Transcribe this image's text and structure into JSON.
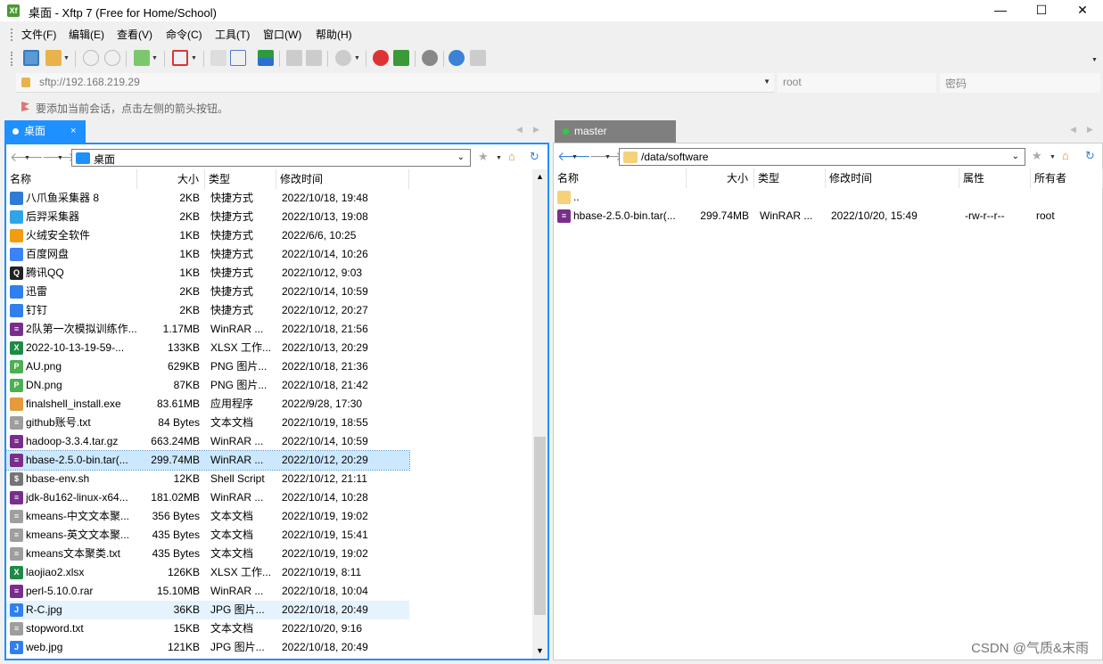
{
  "window": {
    "title": "桌面 - Xftp 7 (Free for Home/School)",
    "minimize": "—",
    "maximize": "☐",
    "close": "✕"
  },
  "menu": [
    "文件(F)",
    "编辑(E)",
    "查看(V)",
    "命令(C)",
    "工具(T)",
    "窗口(W)",
    "帮助(H)"
  ],
  "address": {
    "value": "sftp://192.168.219.29",
    "user": "root",
    "password_placeholder": "密码"
  },
  "hint": "要添加当前会话，点击左侧的箭头按钮。",
  "tabs": {
    "left": "桌面",
    "right": "master"
  },
  "left_pane": {
    "path": "桌面",
    "columns": [
      "名称",
      "大小",
      "类型",
      "修改时间"
    ],
    "files": [
      {
        "name": "八爪鱼采集器 8",
        "size": "2KB",
        "type": "快捷方式",
        "modified": "2022/10/18, 19:48",
        "icon": "octopus-icon"
      },
      {
        "name": "后羿采集器",
        "size": "2KB",
        "type": "快捷方式",
        "modified": "2022/10/13, 19:08",
        "icon": "houyi-icon"
      },
      {
        "name": "火绒安全软件",
        "size": "1KB",
        "type": "快捷方式",
        "modified": "2022/6/6, 10:25",
        "icon": "huorong-icon"
      },
      {
        "name": "百度网盘",
        "size": "1KB",
        "type": "快捷方式",
        "modified": "2022/10/14, 10:26",
        "icon": "baidu-icon"
      },
      {
        "name": "腾讯QQ",
        "size": "1KB",
        "type": "快捷方式",
        "modified": "2022/10/12, 9:03",
        "icon": "qq-icon"
      },
      {
        "name": "迅雷",
        "size": "2KB",
        "type": "快捷方式",
        "modified": "2022/10/14, 10:59",
        "icon": "xunlei-icon"
      },
      {
        "name": "钉钉",
        "size": "2KB",
        "type": "快捷方式",
        "modified": "2022/10/12, 20:27",
        "icon": "dingtalk-icon"
      },
      {
        "name": "2队第一次模拟训练作...",
        "size": "1.17MB",
        "type": "WinRAR ...",
        "modified": "2022/10/18, 21:56",
        "icon": "winrar-icon"
      },
      {
        "name": "2022-10-13-19-59-...",
        "size": "133KB",
        "type": "XLSX 工作...",
        "modified": "2022/10/13, 20:29",
        "icon": "xlsx-icon"
      },
      {
        "name": "AU.png",
        "size": "629KB",
        "type": "PNG 图片...",
        "modified": "2022/10/18, 21:36",
        "icon": "png-icon"
      },
      {
        "name": "DN.png",
        "size": "87KB",
        "type": "PNG 图片...",
        "modified": "2022/10/18, 21:42",
        "icon": "png-icon"
      },
      {
        "name": "finalshell_install.exe",
        "size": "83.61MB",
        "type": "应用程序",
        "modified": "2022/9/28, 17:30",
        "icon": "exe-icon"
      },
      {
        "name": "github账号.txt",
        "size": "84 Bytes",
        "type": "文本文档",
        "modified": "2022/10/19, 18:55",
        "icon": "txt-icon"
      },
      {
        "name": "hadoop-3.3.4.tar.gz",
        "size": "663.24MB",
        "type": "WinRAR ...",
        "modified": "2022/10/14, 10:59",
        "icon": "winrar-icon"
      },
      {
        "name": "hbase-2.5.0-bin.tar(...",
        "size": "299.74MB",
        "type": "WinRAR ...",
        "modified": "2022/10/12, 20:29",
        "icon": "winrar-icon"
      },
      {
        "name": "hbase-env.sh",
        "size": "12KB",
        "type": "Shell Script",
        "modified": "2022/10/12, 21:11",
        "icon": "sh-icon"
      },
      {
        "name": "jdk-8u162-linux-x64...",
        "size": "181.02MB",
        "type": "WinRAR ...",
        "modified": "2022/10/14, 10:28",
        "icon": "winrar-icon"
      },
      {
        "name": "kmeans-中文文本聚...",
        "size": "356 Bytes",
        "type": "文本文档",
        "modified": "2022/10/19, 19:02",
        "icon": "txt-icon"
      },
      {
        "name": "kmeans-英文文本聚...",
        "size": "435 Bytes",
        "type": "文本文档",
        "modified": "2022/10/19, 15:41",
        "icon": "txt-icon"
      },
      {
        "name": "kmeans文本聚类.txt",
        "size": "435 Bytes",
        "type": "文本文档",
        "modified": "2022/10/19, 19:02",
        "icon": "txt-icon"
      },
      {
        "name": "laojiao2.xlsx",
        "size": "126KB",
        "type": "XLSX 工作...",
        "modified": "2022/10/19, 8:11",
        "icon": "xlsx-icon"
      },
      {
        "name": "perl-5.10.0.rar",
        "size": "15.10MB",
        "type": "WinRAR ...",
        "modified": "2022/10/18, 10:04",
        "icon": "winrar-icon"
      },
      {
        "name": "R-C.jpg",
        "size": "36KB",
        "type": "JPG 图片...",
        "modified": "2022/10/18, 20:49",
        "icon": "jpg-icon"
      },
      {
        "name": "stopword.txt",
        "size": "15KB",
        "type": "文本文档",
        "modified": "2022/10/20, 9:16",
        "icon": "txt-icon"
      },
      {
        "name": "web.jpg",
        "size": "121KB",
        "type": "JPG 图片...",
        "modified": "2022/10/18, 20:49",
        "icon": "jpg-icon"
      }
    ]
  },
  "right_pane": {
    "path": "/data/software",
    "columns": [
      "名称",
      "大小",
      "类型",
      "修改时间",
      "属性",
      "所有者"
    ],
    "parent": "..",
    "files": [
      {
        "name": "hbase-2.5.0-bin.tar(...",
        "size": "299.74MB",
        "type": "WinRAR ...",
        "modified": "2022/10/20, 15:49",
        "attr": "-rw-r--r--",
        "owner": "root",
        "icon": "winrar-icon"
      }
    ]
  },
  "watermark": "CSDN @气质&末雨"
}
